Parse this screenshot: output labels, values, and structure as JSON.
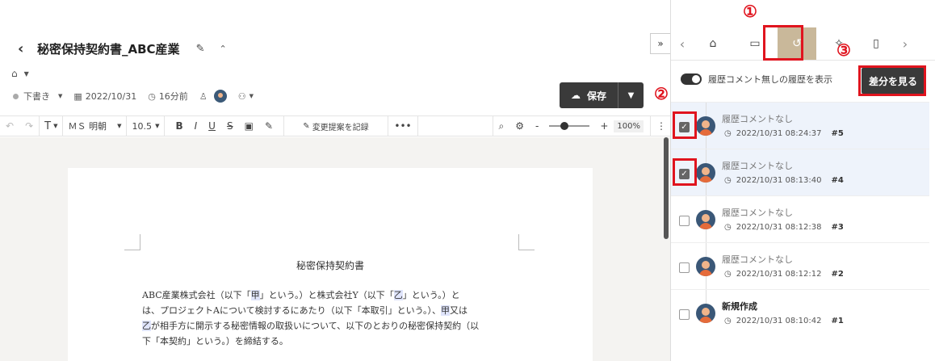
{
  "document": {
    "title": "秘密保持契約書_ABC産業",
    "status": "下書き",
    "date": "2022/10/31",
    "relative_time": "16分前"
  },
  "save_label": "保存",
  "toolbar": {
    "font": "ＭＳ 明朝",
    "size": "10.5",
    "suggest_label": "変更提案を記録",
    "zoom": "100%"
  },
  "page": {
    "heading": "秘密保持契約書",
    "lines": [
      [
        "ABC産業株式会社（以下「",
        "甲",
        "」という。）と株式会社Y（以下「",
        "乙",
        "」という。）と"
      ],
      [
        "は、プロジェクトAについて検討するにあたり（以下「本取引」という。）、",
        "甲",
        "又は"
      ],
      [
        "",
        "乙",
        "が相手方に開示する秘密情報の取扱いについて、以下のとおりの秘密保持契約（以"
      ],
      [
        "下「本契約」という。）を締結する。"
      ]
    ]
  },
  "panel": {
    "toggle_label": "履歴コメント無しの履歴を表示",
    "diff_button": "差分を見る",
    "history": [
      {
        "title": "履歴コメントなし",
        "time": "2022/10/31 08:24:37",
        "num": "#5",
        "checked": true
      },
      {
        "title": "履歴コメントなし",
        "time": "2022/10/31 08:13:40",
        "num": "#4",
        "checked": true
      },
      {
        "title": "履歴コメントなし",
        "time": "2022/10/31 08:12:38",
        "num": "#3",
        "checked": false
      },
      {
        "title": "履歴コメントなし",
        "time": "2022/10/31 08:12:12",
        "num": "#2",
        "checked": false
      },
      {
        "title": "新規作成",
        "time": "2022/10/31 08:10:42",
        "num": "#1",
        "checked": false
      }
    ]
  },
  "annotations": {
    "a1": "①",
    "a2": "②",
    "a3": "③"
  },
  "icons": {
    "active_tab_color": "#c9b89a",
    "annotation_color": "#e0141e"
  }
}
